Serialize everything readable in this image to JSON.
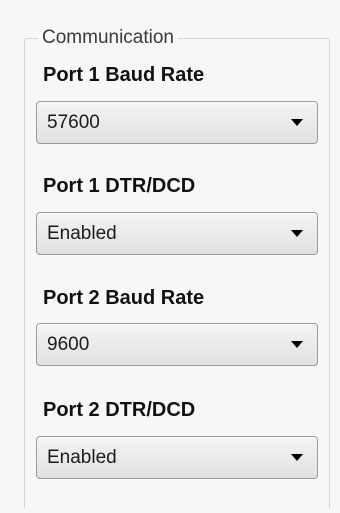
{
  "group": {
    "title": "Communication"
  },
  "fields": [
    {
      "label": "Port 1 Baud Rate",
      "value": "57600"
    },
    {
      "label": "Port 1 DTR/DCD",
      "value": "Enabled"
    },
    {
      "label": "Port 2 Baud Rate",
      "value": "9600"
    },
    {
      "label": "Port 2 DTR/DCD",
      "value": "Enabled"
    }
  ],
  "icons": {
    "dropdown": "chevron-down-icon"
  }
}
